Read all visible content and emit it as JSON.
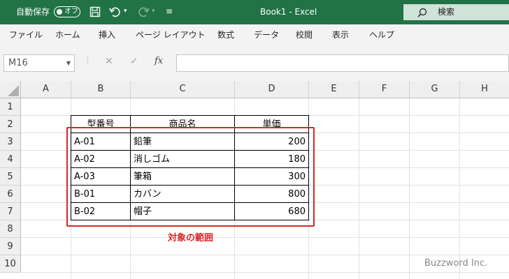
{
  "titlebar": {
    "autosave_label": "自動保存",
    "autosave_state": "オフ",
    "title": "Book1 - Excel",
    "search_placeholder": "検索"
  },
  "menu": [
    "ファイル",
    "ホーム",
    "挿入",
    "ページ レイアウト",
    "数式",
    "データ",
    "校閲",
    "表示",
    "ヘルプ"
  ],
  "formula_bar": {
    "name_box": "M16",
    "fx": "fx",
    "formula": ""
  },
  "columns": [
    "A",
    "B",
    "C",
    "D",
    "E",
    "F",
    "G",
    "H"
  ],
  "rows": [
    "1",
    "2",
    "3",
    "4",
    "5",
    "6",
    "7",
    "8",
    "9",
    "10"
  ],
  "table": {
    "headers": [
      "型番号",
      "商品名",
      "単価"
    ],
    "rows": [
      [
        "A-01",
        "鉛筆",
        "200"
      ],
      [
        "A-02",
        "消しゴム",
        "180"
      ],
      [
        "A-03",
        "筆箱",
        "300"
      ],
      [
        "B-01",
        "カバン",
        "800"
      ],
      [
        "B-02",
        "帽子",
        "680"
      ]
    ]
  },
  "annotation": {
    "label": "対象の範囲",
    "color": "#d9262b"
  },
  "watermark": "Buzzword Inc.",
  "colors": {
    "titlebar": "#217346",
    "ribbon": "#f3f3f3"
  }
}
